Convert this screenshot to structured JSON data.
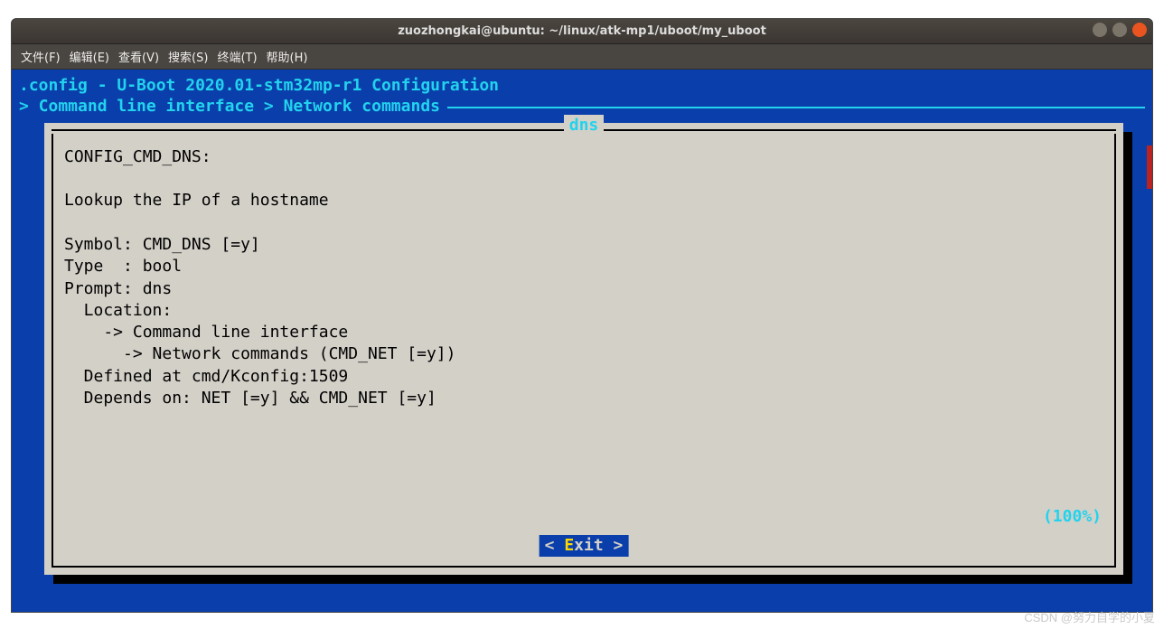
{
  "titlebar": {
    "title": "zuozhongkai@ubuntu: ~/linux/atk-mp1/uboot/my_uboot"
  },
  "menubar": {
    "items": [
      "文件(F)",
      "编辑(E)",
      "查看(V)",
      "搜索(S)",
      "终端(T)",
      "帮助(H)"
    ]
  },
  "header": {
    "line1": ".config - U-Boot 2020.01-stm32mp-r1 Configuration",
    "line2": "> Command line interface > Network commands"
  },
  "dialog": {
    "title": "dns",
    "content": "CONFIG_CMD_DNS:\n\nLookup the IP of a hostname\n\nSymbol: CMD_DNS [=y]\nType  : bool\nPrompt: dns\n  Location:\n    -> Command line interface\n      -> Network commands (CMD_NET [=y])\n  Defined at cmd/Kconfig:1509\n  Depends on: NET [=y] && CMD_NET [=y]",
    "percent": "(100%)",
    "exit_prefix": "< ",
    "exit_hotkey": "E",
    "exit_rest": "xit >"
  },
  "watermark": "CSDN @努力自学的小夏"
}
